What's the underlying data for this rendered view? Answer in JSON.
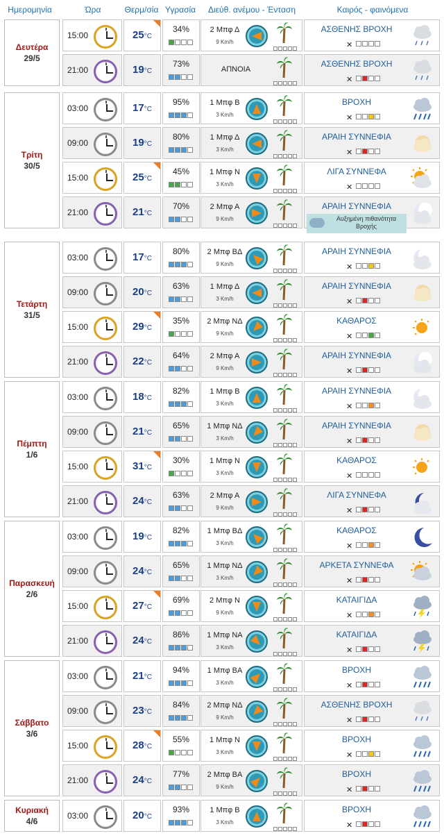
{
  "header": {
    "date": "Ημερομηνία",
    "time": "Ώρα",
    "temp": "Θερμ/σία",
    "humidity": "Υγρασία",
    "wind": "Διεύθ. ανέμου - Ένταση",
    "weather": "Καιρός - φαινόμενα"
  },
  "temp_unit": "°C",
  "days": [
    {
      "name": "Δευτέρα",
      "date": "29/5",
      "rows": [
        {
          "time": "15:00",
          "temp": "25",
          "hum": "34%",
          "hum_level": 1,
          "hum_color": "green",
          "wind": "2 Μπφ Δ",
          "speed": "9 Km/h",
          "dir": "W",
          "calm": false,
          "weather": "ΑΣΘΕΝΗΣ ΒΡΟΧΗ",
          "mosq": 2,
          "mosq_color": "gray",
          "icon": "light-rain",
          "hot": true
        },
        {
          "time": "21:00",
          "temp": "19",
          "hum": "73%",
          "hum_level": 2,
          "hum_color": "blue",
          "wind": "ΑΠΝΟΙΑ",
          "speed": "",
          "dir": "",
          "calm": true,
          "weather": "ΑΣΘΕΝΗΣ ΒΡΟΧΗ",
          "mosq": 1,
          "mosq_color": "red",
          "icon": "light-rain",
          "hot": false
        }
      ]
    },
    {
      "name": "Τρίτη",
      "date": "30/5",
      "rows": [
        {
          "time": "03:00",
          "temp": "17",
          "hum": "95%",
          "hum_level": 3,
          "hum_color": "blue",
          "wind": "1 Μπφ Β",
          "speed": "3 Km/h",
          "dir": "N",
          "calm": false,
          "weather": "ΒΡΟΧΗ",
          "mosq": 2,
          "mosq_color": "yellow",
          "icon": "rain",
          "hot": false
        },
        {
          "time": "09:00",
          "temp": "19",
          "hum": "80%",
          "hum_level": 3,
          "hum_color": "blue",
          "wind": "1 Μπφ Δ",
          "speed": "3 Km/h",
          "dir": "W",
          "calm": false,
          "weather": "ΑΡΑΙΗ ΣΥΝΝΕΦΙΑ",
          "mosq": 1,
          "mosq_color": "red",
          "icon": "few-clouds-day",
          "hot": false
        },
        {
          "time": "15:00",
          "temp": "25",
          "hum": "45%",
          "hum_level": 2,
          "hum_color": "green",
          "wind": "1 Μπφ Ν",
          "speed": "3 Km/h",
          "dir": "S",
          "calm": false,
          "weather": "ΛΙΓΑ ΣΥΝΝΕΦΑ",
          "mosq": 1,
          "mosq_color": "gray",
          "icon": "partly-sunny",
          "hot": true
        },
        {
          "time": "21:00",
          "temp": "21",
          "hum": "70%",
          "hum_level": 2,
          "hum_color": "blue",
          "wind": "2 Μπφ Α",
          "speed": "9 Km/h",
          "dir": "E",
          "calm": false,
          "weather": "ΑΡΑΙΗ ΣΥΝΝΕΦΙΑ",
          "note": "Αυξημένη πιθανότητα Βροχής",
          "mosq": 0,
          "mosq_color": "gray",
          "icon": "few-clouds-night",
          "hot": false
        }
      ]
    },
    {
      "name": "Τετάρτη",
      "date": "31/5",
      "rows": [
        {
          "time": "03:00",
          "temp": "17",
          "hum": "80%",
          "hum_level": 3,
          "hum_color": "blue",
          "wind": "2 Μπφ ΒΔ",
          "speed": "9 Km/h",
          "dir": "NW",
          "calm": false,
          "weather": "ΑΡΑΙΗ ΣΥΝΝΕΦΙΑ",
          "mosq": 2,
          "mosq_color": "yellow",
          "icon": "few-clouds-night",
          "hot": false
        },
        {
          "time": "09:00",
          "temp": "20",
          "hum": "63%",
          "hum_level": 2,
          "hum_color": "blue",
          "wind": "1 Μπφ Δ",
          "speed": "3 Km/h",
          "dir": "W",
          "calm": false,
          "weather": "ΑΡΑΙΗ ΣΥΝΝΕΦΙΑ",
          "mosq": 1,
          "mosq_color": "red",
          "icon": "few-clouds-day",
          "hot": false
        },
        {
          "time": "15:00",
          "temp": "29",
          "hum": "35%",
          "hum_level": 1,
          "hum_color": "green",
          "wind": "2 Μπφ ΝΔ",
          "speed": "9 Km/h",
          "dir": "SW",
          "calm": false,
          "weather": "ΚΑΘΑΡΟΣ",
          "mosq": 2,
          "mosq_color": "green",
          "icon": "clear-day",
          "hot": true
        },
        {
          "time": "21:00",
          "temp": "22",
          "hum": "64%",
          "hum_level": 2,
          "hum_color": "blue",
          "wind": "2 Μπφ Α",
          "speed": "9 Km/h",
          "dir": "E",
          "calm": false,
          "weather": "ΑΡΑΙΗ ΣΥΝΝΕΦΙΑ",
          "mosq": 1,
          "mosq_color": "red",
          "icon": "few-clouds-night",
          "hot": false
        }
      ]
    },
    {
      "name": "Πέμπτη",
      "date": "1/6",
      "rows": [
        {
          "time": "03:00",
          "temp": "18",
          "hum": "82%",
          "hum_level": 3,
          "hum_color": "blue",
          "wind": "1 Μπφ Β",
          "speed": "3 Km/h",
          "dir": "N",
          "calm": false,
          "weather": "ΑΡΑΙΗ ΣΥΝΝΕΦΙΑ",
          "mosq": 2,
          "mosq_color": "orange",
          "icon": "few-clouds-night",
          "hot": false
        },
        {
          "time": "09:00",
          "temp": "21",
          "hum": "65%",
          "hum_level": 2,
          "hum_color": "blue",
          "wind": "1 Μπφ ΝΔ",
          "speed": "3 Km/h",
          "dir": "SW",
          "calm": false,
          "weather": "ΑΡΑΙΗ ΣΥΝΝΕΦΙΑ",
          "mosq": 1,
          "mosq_color": "red",
          "icon": "few-clouds-day",
          "hot": false
        },
        {
          "time": "15:00",
          "temp": "31",
          "hum": "30%",
          "hum_level": 1,
          "hum_color": "green",
          "wind": "1 Μπφ Ν",
          "speed": "3 Km/h",
          "dir": "S",
          "calm": false,
          "weather": "ΚΑΘΑΡΟΣ",
          "mosq": 0,
          "mosq_color": "gray",
          "icon": "clear-day",
          "hot": true
        },
        {
          "time": "21:00",
          "temp": "24",
          "hum": "63%",
          "hum_level": 2,
          "hum_color": "blue",
          "wind": "2 Μπφ Α",
          "speed": "9 Km/h",
          "dir": "E",
          "calm": false,
          "weather": "ΛΙΓΑ ΣΥΝΝΕΦΑ",
          "mosq": 1,
          "mosq_color": "red",
          "icon": "moon-cloud",
          "hot": false
        }
      ]
    },
    {
      "name": "Παρασκευή",
      "date": "2/6",
      "rows": [
        {
          "time": "03:00",
          "temp": "19",
          "hum": "82%",
          "hum_level": 3,
          "hum_color": "blue",
          "wind": "1 Μπφ ΒΔ",
          "speed": "3 Km/h",
          "dir": "NW",
          "calm": false,
          "weather": "ΚΑΘΑΡΟΣ",
          "mosq": 2,
          "mosq_color": "orange",
          "icon": "clear-night",
          "hot": false
        },
        {
          "time": "09:00",
          "temp": "24",
          "hum": "65%",
          "hum_level": 2,
          "hum_color": "blue",
          "wind": "1 Μπφ ΝΔ",
          "speed": "3 Km/h",
          "dir": "SW",
          "calm": false,
          "weather": "ΑΡΚΕΤΑ ΣΥΝΝΕΦΑ",
          "mosq": 1,
          "mosq_color": "red",
          "icon": "cloudy-sun",
          "hot": false
        },
        {
          "time": "15:00",
          "temp": "27",
          "hum": "69%",
          "hum_level": 2,
          "hum_color": "blue",
          "wind": "2 Μπφ Ν",
          "speed": "9 Km/h",
          "dir": "S",
          "calm": false,
          "weather": "ΚΑΤΑΙΓΙΔΑ",
          "mosq": 2,
          "mosq_color": "orange",
          "icon": "storm",
          "hot": true
        },
        {
          "time": "21:00",
          "temp": "24",
          "hum": "86%",
          "hum_level": 3,
          "hum_color": "blue",
          "wind": "1 Μπφ ΝΑ",
          "speed": "3 Km/h",
          "dir": "SE",
          "calm": false,
          "weather": "ΚΑΤΑΙΓΙΔΑ",
          "mosq": 1,
          "mosq_color": "red",
          "icon": "storm",
          "hot": false
        }
      ]
    },
    {
      "name": "Σάββατο",
      "date": "3/6",
      "rows": [
        {
          "time": "03:00",
          "temp": "21",
          "hum": "94%",
          "hum_level": 3,
          "hum_color": "blue",
          "wind": "1 Μπφ ΒΑ",
          "speed": "3 Km/h",
          "dir": "NE",
          "calm": false,
          "weather": "ΒΡΟΧΗ",
          "mosq": 1,
          "mosq_color": "red",
          "icon": "rain",
          "hot": false
        },
        {
          "time": "09:00",
          "temp": "23",
          "hum": "84%",
          "hum_level": 3,
          "hum_color": "blue",
          "wind": "2 Μπφ ΝΔ",
          "speed": "9 Km/h",
          "dir": "SW",
          "calm": false,
          "weather": "ΑΣΘΕΝΗΣ ΒΡΟΧΗ",
          "mosq": 1,
          "mosq_color": "red",
          "icon": "light-rain",
          "hot": false
        },
        {
          "time": "15:00",
          "temp": "28",
          "hum": "55%",
          "hum_level": 1,
          "hum_color": "green",
          "wind": "1 Μπφ Ν",
          "speed": "3 Km/h",
          "dir": "S",
          "calm": false,
          "weather": "ΒΡΟΧΗ",
          "mosq": 2,
          "mosq_color": "yellow",
          "icon": "rain",
          "hot": true
        },
        {
          "time": "21:00",
          "temp": "24",
          "hum": "77%",
          "hum_level": 2,
          "hum_color": "blue",
          "wind": "2 Μπφ ΒΑ",
          "speed": "9 Km/h",
          "dir": "NE",
          "calm": false,
          "weather": "ΒΡΟΧΗ",
          "mosq": 1,
          "mosq_color": "red",
          "icon": "rain",
          "hot": false
        }
      ]
    },
    {
      "name": "Κυριακή",
      "date": "4/6",
      "rows": [
        {
          "time": "03:00",
          "temp": "20",
          "hum": "93%",
          "hum_level": 3,
          "hum_color": "blue",
          "wind": "1 Μπφ Β",
          "speed": "3 Km/h",
          "dir": "N",
          "calm": false,
          "weather": "ΒΡΟΧΗ",
          "mosq": 1,
          "mosq_color": "red",
          "icon": "rain",
          "hot": false
        }
      ]
    }
  ]
}
